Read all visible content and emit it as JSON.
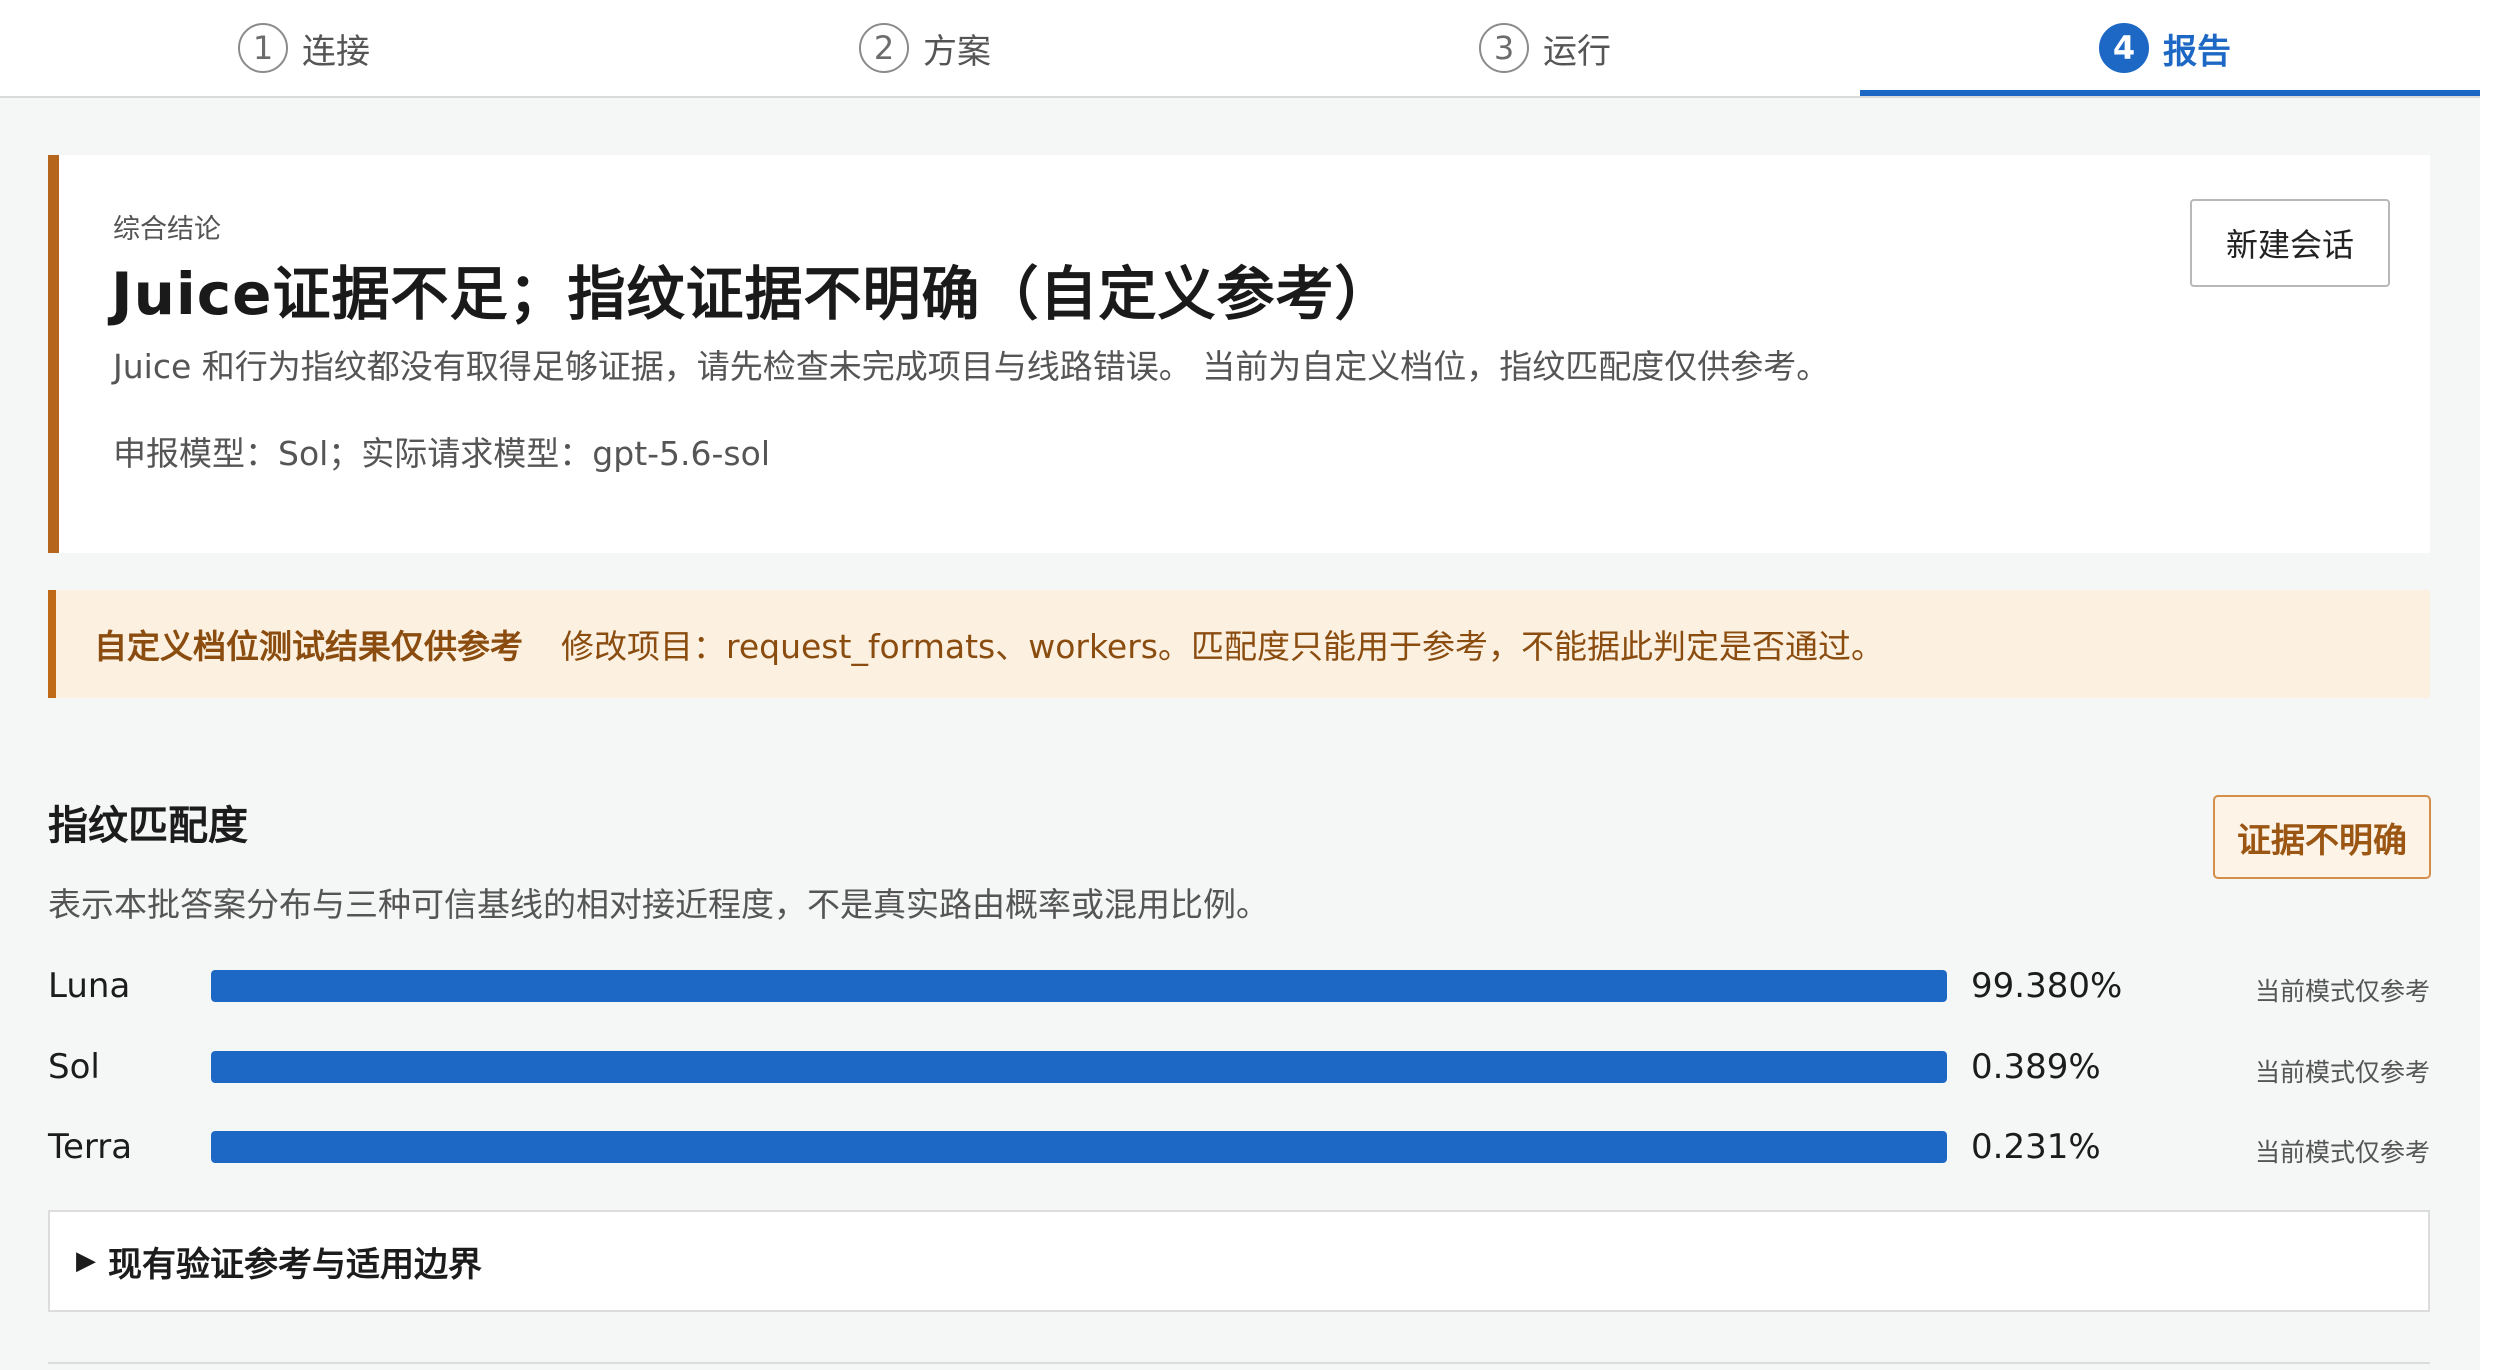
{
  "steps": [
    {
      "num": "1",
      "label": "连接"
    },
    {
      "num": "2",
      "label": "方案"
    },
    {
      "num": "3",
      "label": "运行"
    },
    {
      "num": "4",
      "label": "报告"
    }
  ],
  "active_step": 4,
  "summary": {
    "kicker": "综合结论",
    "headline": "Juice证据不足；指纹证据不明确（自定义参考）",
    "description": "Juice 和行为指纹都没有取得足够证据，请先检查未完成项目与线路错误。 当前为自定义档位，指纹匹配度仅供参考。",
    "models": "申报模型：Sol；实际请求模型：gpt-5.6-sol",
    "new_session_label": "新建会话"
  },
  "warning": {
    "title": "自定义档位测试结果仅供参考",
    "text": "修改项目：request_formats、workers。匹配度只能用于参考，不能据此判定是否通过。"
  },
  "fingerprint": {
    "title": "指纹匹配度",
    "badge": "证据不明确",
    "description": "表示本批答案分布与三种可信基线的相对接近程度，不是真实路由概率或混用比例。",
    "rows": [
      {
        "name": "Luna",
        "percent": "99.380%",
        "note": "当前模式仅参考",
        "fill": 1.0
      },
      {
        "name": "Sol",
        "percent": "0.389%",
        "note": "当前模式仅参考",
        "fill": 1.0
      },
      {
        "name": "Terra",
        "percent": "0.231%",
        "note": "当前模式仅参考",
        "fill": 1.0
      }
    ]
  },
  "expander": {
    "icon": "triangle-right-icon",
    "label": "现有验证参考与适用边界"
  },
  "colors": {
    "accent": "#1d68c4",
    "summary_border": "#b5661c",
    "warning_bg": "#fcf1e1",
    "warning_text": "#8a4c0f"
  }
}
